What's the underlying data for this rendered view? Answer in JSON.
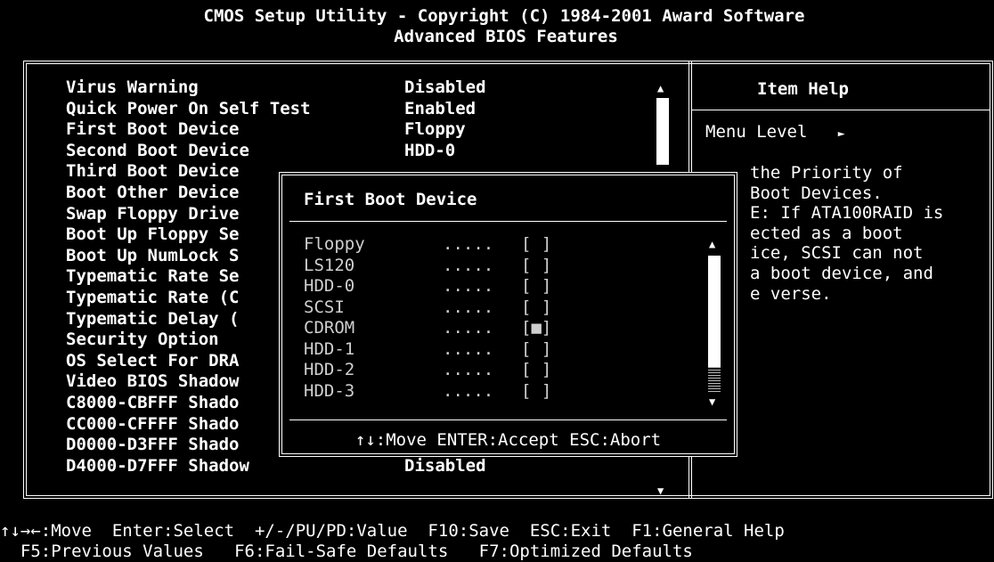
{
  "header": {
    "line1": "CMOS Setup Utility - Copyright (C) 1984-2001 Award Software",
    "line2": "Advanced BIOS Features"
  },
  "settings": [
    {
      "name": "Virus Warning",
      "value": "Disabled"
    },
    {
      "name": "Quick Power On Self Test",
      "value": "Enabled"
    },
    {
      "name": "First Boot Device",
      "value": "Floppy"
    },
    {
      "name": "Second Boot Device",
      "value": "HDD-0"
    },
    {
      "name": "Third Boot Device",
      "value": ""
    },
    {
      "name": "Boot Other Device",
      "value": ""
    },
    {
      "name": "Swap Floppy Drive",
      "value": ""
    },
    {
      "name": "Boot Up Floppy Se",
      "value": ""
    },
    {
      "name": "Boot Up NumLock S",
      "value": ""
    },
    {
      "name": "Typematic Rate Se",
      "value": ""
    },
    {
      "name": "Typematic Rate (C",
      "value": ""
    },
    {
      "name": "Typematic Delay (",
      "value": ""
    },
    {
      "name": "Security Option",
      "value": ""
    },
    {
      "name": "OS Select For DRA",
      "value": ""
    },
    {
      "name": "Video BIOS Shadow",
      "value": ""
    },
    {
      "name": "C8000-CBFFF Shado",
      "value": ""
    },
    {
      "name": "CC000-CFFFF Shado",
      "value": ""
    },
    {
      "name": "D0000-D3FFF Shado",
      "value": ""
    },
    {
      "name": "D4000-D7FFF Shadow",
      "value": "Disabled"
    }
  ],
  "help": {
    "title": "Item Help",
    "menu_level": "Menu Level",
    "menu_level_arrow": "►",
    "lines": [
      "the Priority of",
      "Boot Devices.",
      "E: If ATA100RAID is",
      "ected as a boot",
      "ice, SCSI can not",
      "a boot device, and",
      "e verse."
    ]
  },
  "popup": {
    "title": "First Boot Device",
    "options": [
      {
        "name": "Floppy",
        "dots": ".....",
        "check": "[ ]"
      },
      {
        "name": "LS120",
        "dots": ".....",
        "check": "[ ]"
      },
      {
        "name": "HDD-0",
        "dots": ".....",
        "check": "[ ]"
      },
      {
        "name": "SCSI",
        "dots": ".....",
        "check": "[ ]"
      },
      {
        "name": "CDROM",
        "dots": ".....",
        "check": "[■]"
      },
      {
        "name": "HDD-1",
        "dots": ".....",
        "check": "[ ]"
      },
      {
        "name": "HDD-2",
        "dots": ".....",
        "check": "[ ]"
      },
      {
        "name": "HDD-3",
        "dots": ".....",
        "check": "[ ]"
      }
    ],
    "selected": "CDROM",
    "help": "↑↓:Move ENTER:Accept ESC:Abort"
  },
  "footer": {
    "line1": "↑↓→←:Move  Enter:Select  +/-/PU/PD:Value  F10:Save  ESC:Exit  F1:General Help",
    "line2": "  F5:Previous Values   F6:Fail-Safe Defaults   F7:Optimized Defaults"
  },
  "arrows": {
    "up": "▲",
    "down": "▼"
  },
  "colors": {
    "background": "#000000",
    "foreground": "#ffffff",
    "dim": "#cfcfcf"
  }
}
